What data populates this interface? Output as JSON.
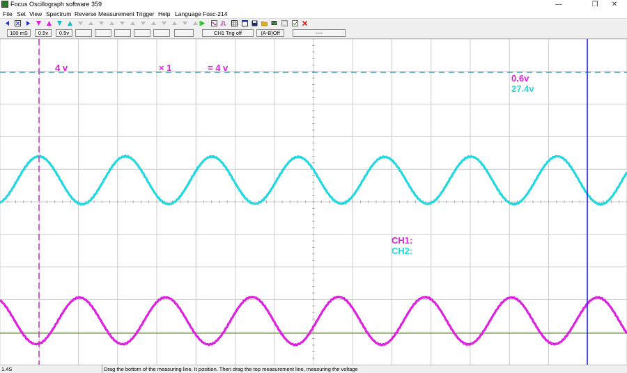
{
  "window": {
    "title": "Focus Oscillograph software 359",
    "minimize_glyph": "—",
    "restore_glyph": "❐",
    "close_glyph": "✕"
  },
  "menu": [
    "File",
    "Set",
    "View",
    "Spectrum",
    "Reverse",
    "Measurement",
    "Trigger",
    "Help",
    "Language",
    "Fosc-214"
  ],
  "toolbar_icons": [
    "arrow-left-icon",
    "cross-box-icon",
    "arrow-right-icon",
    "triangle-down-icon",
    "triangle-up-icon",
    "triangle-down-cyan-icon",
    "triangle-up-cyan-icon",
    "gray-triangle-icon",
    "gray-triangle-icon",
    "gray-triangle-icon",
    "gray-triangle-icon",
    "gray-triangle-icon",
    "gray-triangle-icon",
    "gray-triangle-icon",
    "gray-triangle-icon",
    "gray-triangle-icon",
    "gray-triangle-icon",
    "gray-triangle-icon",
    "gray-triangle-icon",
    "gray-triangle-icon",
    "gray-triangle-icon",
    "play-icon",
    "waveform-icon",
    "pulse-icon",
    "grid-icon",
    "window-icon",
    "save-icon",
    "open-folder-icon",
    "scope-icon",
    "copy-icon",
    "checkbox-icon",
    "close-icon"
  ],
  "status_fields": [
    "100 mS",
    "0.5v",
    "0.5v",
    "",
    "",
    "",
    "",
    "",
    "",
    "CH1 Trig off",
    "(A-B)Off",
    "----"
  ],
  "overlay": {
    "ch1_volts": "4 v",
    "multiplier": "× 1",
    "result": "= 4 v",
    "ch2_cursor": "0.6v",
    "ch2_measure": "27.4v",
    "ch1_label": "CH1:",
    "ch2_label": "CH2:"
  },
  "colors": {
    "ch1": "#e020e0",
    "ch2": "#20d8e0",
    "cursor_dashed": "#c030c0",
    "cursor_blue": "#2020e0",
    "h_dashed": "#2090b0",
    "baseline": "#4a7a10",
    "grid": "#cccccc"
  },
  "status_bar": {
    "left": "1.4S",
    "message": "Drag the bottom of the measuring line. It position. Then drag the top measurement line, measuring the voltage"
  }
}
